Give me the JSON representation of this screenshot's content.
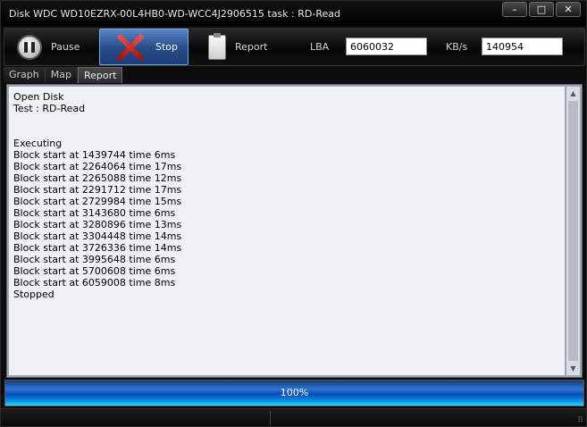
{
  "window": {
    "title": "Disk WDC WD10EZRX-00L4HB0-WD-WCC4J2906515   task : RD-Read",
    "controls": {
      "minimize": "–",
      "maximize": "□",
      "close": "✕"
    }
  },
  "toolbar": {
    "pause_label": "Pause",
    "stop_label": "Stop",
    "report_label": "Report",
    "lba_label": "LBA",
    "lba_value": "6060032",
    "kbs_label": "KB/s",
    "kbs_value": "140954"
  },
  "tabs": [
    {
      "label": "Graph",
      "active": false
    },
    {
      "label": "Map",
      "active": false
    },
    {
      "label": "Report",
      "active": true
    }
  ],
  "log": {
    "lines": [
      "Open Disk",
      "Test : RD-Read",
      "",
      "",
      "Executing",
      "Block start at 1439744 time 6ms",
      "Block start at 2264064 time 17ms",
      "Block start at 2265088 time 12ms",
      "Block start at 2291712 time 17ms",
      "Block start at 2729984 time 15ms",
      "Block start at 3143680 time 6ms",
      "Block start at 3280896 time 13ms",
      "Block start at 3304448 time 14ms",
      "Block start at 3726336 time 14ms",
      "Block start at 3995648 time 6ms",
      "Block start at 5700608 time 6ms",
      "Block start at 6059008 time 8ms",
      "Stopped"
    ]
  },
  "progress": {
    "value_percent": 100,
    "label": "100%"
  },
  "colors": {
    "stop_active": "#2a4e8c",
    "progress_fill": "#2a78d8",
    "log_bg": "#eef2f6"
  }
}
